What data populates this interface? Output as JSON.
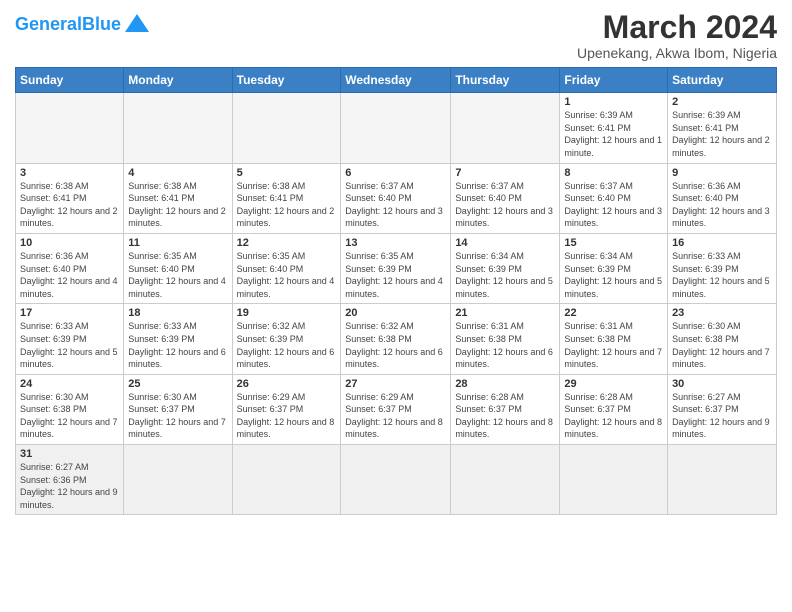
{
  "header": {
    "logo_general": "General",
    "logo_blue": "Blue",
    "month_title": "March 2024",
    "subtitle": "Upenekang, Akwa Ibom, Nigeria"
  },
  "weekdays": [
    "Sunday",
    "Monday",
    "Tuesday",
    "Wednesday",
    "Thursday",
    "Friday",
    "Saturday"
  ],
  "weeks": [
    [
      {
        "day": "",
        "info": ""
      },
      {
        "day": "",
        "info": ""
      },
      {
        "day": "",
        "info": ""
      },
      {
        "day": "",
        "info": ""
      },
      {
        "day": "",
        "info": ""
      },
      {
        "day": "1",
        "info": "Sunrise: 6:39 AM\nSunset: 6:41 PM\nDaylight: 12 hours and 1 minute."
      },
      {
        "day": "2",
        "info": "Sunrise: 6:39 AM\nSunset: 6:41 PM\nDaylight: 12 hours and 2 minutes."
      }
    ],
    [
      {
        "day": "3",
        "info": "Sunrise: 6:38 AM\nSunset: 6:41 PM\nDaylight: 12 hours and 2 minutes."
      },
      {
        "day": "4",
        "info": "Sunrise: 6:38 AM\nSunset: 6:41 PM\nDaylight: 12 hours and 2 minutes."
      },
      {
        "day": "5",
        "info": "Sunrise: 6:38 AM\nSunset: 6:41 PM\nDaylight: 12 hours and 2 minutes."
      },
      {
        "day": "6",
        "info": "Sunrise: 6:37 AM\nSunset: 6:40 PM\nDaylight: 12 hours and 3 minutes."
      },
      {
        "day": "7",
        "info": "Sunrise: 6:37 AM\nSunset: 6:40 PM\nDaylight: 12 hours and 3 minutes."
      },
      {
        "day": "8",
        "info": "Sunrise: 6:37 AM\nSunset: 6:40 PM\nDaylight: 12 hours and 3 minutes."
      },
      {
        "day": "9",
        "info": "Sunrise: 6:36 AM\nSunset: 6:40 PM\nDaylight: 12 hours and 3 minutes."
      }
    ],
    [
      {
        "day": "10",
        "info": "Sunrise: 6:36 AM\nSunset: 6:40 PM\nDaylight: 12 hours and 4 minutes."
      },
      {
        "day": "11",
        "info": "Sunrise: 6:35 AM\nSunset: 6:40 PM\nDaylight: 12 hours and 4 minutes."
      },
      {
        "day": "12",
        "info": "Sunrise: 6:35 AM\nSunset: 6:40 PM\nDaylight: 12 hours and 4 minutes."
      },
      {
        "day": "13",
        "info": "Sunrise: 6:35 AM\nSunset: 6:39 PM\nDaylight: 12 hours and 4 minutes."
      },
      {
        "day": "14",
        "info": "Sunrise: 6:34 AM\nSunset: 6:39 PM\nDaylight: 12 hours and 5 minutes."
      },
      {
        "day": "15",
        "info": "Sunrise: 6:34 AM\nSunset: 6:39 PM\nDaylight: 12 hours and 5 minutes."
      },
      {
        "day": "16",
        "info": "Sunrise: 6:33 AM\nSunset: 6:39 PM\nDaylight: 12 hours and 5 minutes."
      }
    ],
    [
      {
        "day": "17",
        "info": "Sunrise: 6:33 AM\nSunset: 6:39 PM\nDaylight: 12 hours and 5 minutes."
      },
      {
        "day": "18",
        "info": "Sunrise: 6:33 AM\nSunset: 6:39 PM\nDaylight: 12 hours and 6 minutes."
      },
      {
        "day": "19",
        "info": "Sunrise: 6:32 AM\nSunset: 6:39 PM\nDaylight: 12 hours and 6 minutes."
      },
      {
        "day": "20",
        "info": "Sunrise: 6:32 AM\nSunset: 6:38 PM\nDaylight: 12 hours and 6 minutes."
      },
      {
        "day": "21",
        "info": "Sunrise: 6:31 AM\nSunset: 6:38 PM\nDaylight: 12 hours and 6 minutes."
      },
      {
        "day": "22",
        "info": "Sunrise: 6:31 AM\nSunset: 6:38 PM\nDaylight: 12 hours and 7 minutes."
      },
      {
        "day": "23",
        "info": "Sunrise: 6:30 AM\nSunset: 6:38 PM\nDaylight: 12 hours and 7 minutes."
      }
    ],
    [
      {
        "day": "24",
        "info": "Sunrise: 6:30 AM\nSunset: 6:38 PM\nDaylight: 12 hours and 7 minutes."
      },
      {
        "day": "25",
        "info": "Sunrise: 6:30 AM\nSunset: 6:37 PM\nDaylight: 12 hours and 7 minutes."
      },
      {
        "day": "26",
        "info": "Sunrise: 6:29 AM\nSunset: 6:37 PM\nDaylight: 12 hours and 8 minutes."
      },
      {
        "day": "27",
        "info": "Sunrise: 6:29 AM\nSunset: 6:37 PM\nDaylight: 12 hours and 8 minutes."
      },
      {
        "day": "28",
        "info": "Sunrise: 6:28 AM\nSunset: 6:37 PM\nDaylight: 12 hours and 8 minutes."
      },
      {
        "day": "29",
        "info": "Sunrise: 6:28 AM\nSunset: 6:37 PM\nDaylight: 12 hours and 8 minutes."
      },
      {
        "day": "30",
        "info": "Sunrise: 6:27 AM\nSunset: 6:37 PM\nDaylight: 12 hours and 9 minutes."
      }
    ],
    [
      {
        "day": "31",
        "info": "Sunrise: 6:27 AM\nSunset: 6:36 PM\nDaylight: 12 hours and 9 minutes."
      },
      {
        "day": "",
        "info": ""
      },
      {
        "day": "",
        "info": ""
      },
      {
        "day": "",
        "info": ""
      },
      {
        "day": "",
        "info": ""
      },
      {
        "day": "",
        "info": ""
      },
      {
        "day": "",
        "info": ""
      }
    ]
  ]
}
